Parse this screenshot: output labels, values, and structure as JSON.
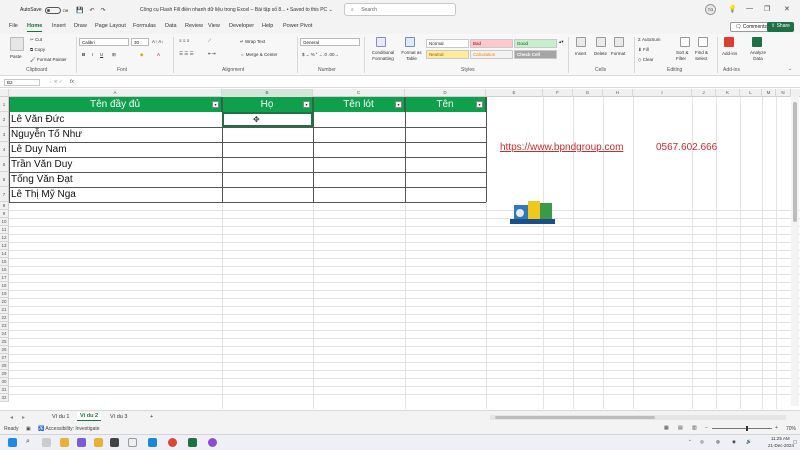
{
  "titlebar": {
    "autosave_label": "AutoSave",
    "toggle_state": "Off",
    "doc_title": "Công cụ Flash Fill điền nhanh dữ liệu trong Excel – Bài tập số 8...  •  Saved to this PC  ⌄",
    "search_placeholder": "Search",
    "avatar_initials": "TG",
    "minimize": "—",
    "restore": "❐",
    "close": "✕"
  },
  "menu": {
    "tabs": [
      "File",
      "Home",
      "Insert",
      "Draw",
      "Page Layout",
      "Formulas",
      "Data",
      "Review",
      "View",
      "Developer",
      "Help",
      "Power Pivot"
    ],
    "active": "Home",
    "comments_label": "Comments",
    "share_label": "Share"
  },
  "ribbon": {
    "paste_label": "Paste",
    "cut_label": "Cut",
    "copy_label": "Copy",
    "format_painter_label": "Format Painter",
    "clipboard_group": "Clipboard",
    "font_name": "Calibri",
    "font_size": "30",
    "font_group": "Font",
    "wrap_text_label": "Wrap Text",
    "merge_center_label": "Merge & Center",
    "alignment_group": "Alignment",
    "number_format": "General",
    "number_group": "Number",
    "conditional_formatting_label": "Conditional Formatting",
    "format_as_table_label": "Format as Table",
    "styles": [
      "Normal",
      "Bad",
      "Good",
      "Neutral",
      "Calculation",
      "Check Cell"
    ],
    "styles_group": "Styles",
    "insert_label": "Insert",
    "delete_label": "Delete",
    "format_label": "Format",
    "cells_group": "Cells",
    "autosum_label": "AutoSum",
    "fill_label": "Fill",
    "clear_label": "Clear",
    "sort_filter_label": "Sort & Filter",
    "find_select_label": "Find & Select",
    "editing_group": "Editing",
    "addins_label": "Add-ins",
    "analyze_data_label": "Analyze Data",
    "addins_group": "Add-ins"
  },
  "formula_bar": {
    "name_box": "B2",
    "fx": "fx",
    "content": ""
  },
  "grid": {
    "columns": [
      "A",
      "B",
      "C",
      "D",
      "E",
      "F",
      "G",
      "H",
      "I",
      "J",
      "K",
      "L",
      "M",
      "N",
      "O"
    ],
    "rows": [
      "1",
      "2",
      "3",
      "4",
      "5",
      "6",
      "7",
      "8",
      "9",
      "10",
      "11",
      "12",
      "13",
      "14",
      "15",
      "16",
      "17",
      "18",
      "19",
      "20",
      "21",
      "22",
      "23",
      "24",
      "25",
      "26",
      "27",
      "28",
      "29",
      "30",
      "31",
      "32"
    ],
    "table_headers": [
      "Tên đầy đủ",
      "Họ",
      "Tên lót",
      "Tên"
    ],
    "full_names": [
      "Lê Văn Đức",
      "Nguyễn Tố Như",
      "Lê Duy Nam",
      "Trần Văn Duy",
      "Tống Văn Đạt",
      "Lê Thị Mỹ Nga"
    ],
    "header_color": "#0fa04b",
    "link": "https://www.bpndgroup.com",
    "phone": "0567.602.666",
    "link_color": "#cf2a2a"
  },
  "sheets": {
    "tabs": [
      "Ví du 1",
      "Ví du 2",
      "Ví du 3"
    ],
    "active": "Ví du 2",
    "add": "+"
  },
  "status": {
    "ready": "Ready",
    "accessibility": "Accessibility: Investigate",
    "zoom": "70%"
  },
  "taskbar": {
    "time": "11:25 AM",
    "date": "21-Dec-2024"
  }
}
